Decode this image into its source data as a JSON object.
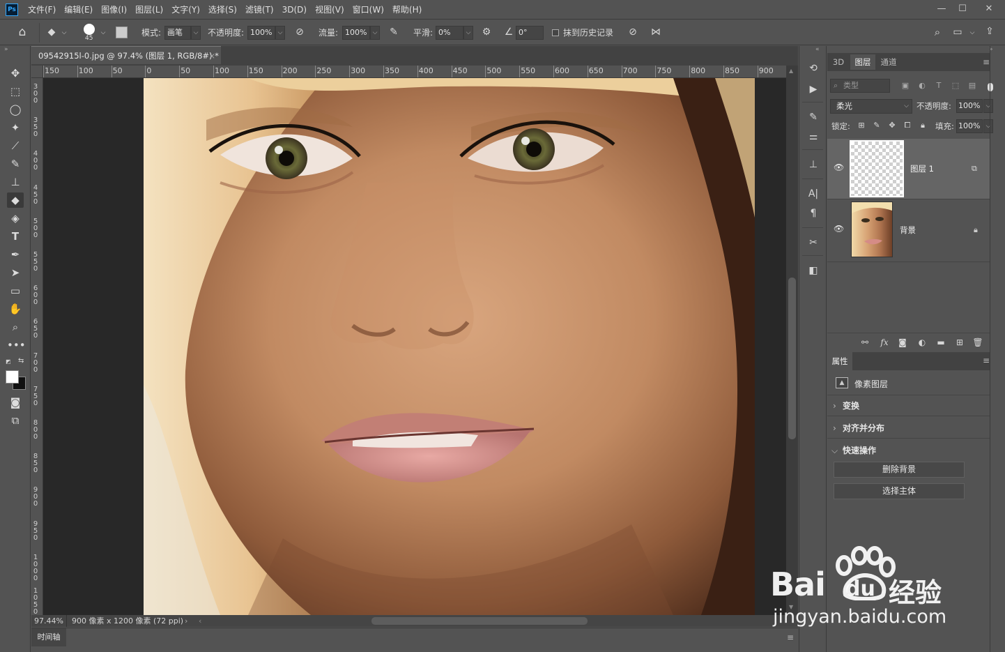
{
  "menubar": {
    "logo": "Ps",
    "items": [
      "文件(F)",
      "编辑(E)",
      "图像(I)",
      "图层(L)",
      "文字(Y)",
      "选择(S)",
      "滤镜(T)",
      "3D(D)",
      "视图(V)",
      "窗口(W)",
      "帮助(H)"
    ]
  },
  "options": {
    "brush_size": "45",
    "mode_label": "模式:",
    "mode_value": "画笔",
    "opacity_label": "不透明度:",
    "opacity_value": "100%",
    "flow_label": "流量:",
    "flow_value": "100%",
    "smoothing_label": "平滑:",
    "smoothing_value": "0%",
    "angle_value": "0°",
    "history_label": "抹到历史记录"
  },
  "document": {
    "tab_title": "09542915l-0.jpg @ 97.4% (图层 1, RGB/8#) *",
    "zoom": "97.44%",
    "dimensions": "900 像素 x 1200 像素 (72 ppi)"
  },
  "ruler": {
    "h_labels": [
      "150",
      "100",
      "50",
      "0",
      "50",
      "100",
      "150",
      "200",
      "250",
      "300",
      "350",
      "400",
      "450",
      "500",
      "550",
      "600",
      "650",
      "700",
      "750",
      "800",
      "850",
      "900"
    ],
    "v_labels": [
      "300",
      "350",
      "400",
      "450",
      "500",
      "550",
      "600",
      "650",
      "700",
      "750",
      "800",
      "850",
      "900",
      "950",
      "1000",
      "1050"
    ]
  },
  "timeline_tab": "时间轴",
  "panels": {
    "tabs": [
      "3D",
      "图层",
      "通道"
    ],
    "filter_placeholder": "类型",
    "blend_mode": "柔光",
    "opacity_label": "不透明度:",
    "opacity_value": "100%",
    "lock_label": "锁定:",
    "fill_label": "填充:",
    "fill_value": "100%",
    "layers": [
      {
        "name": "图层 1"
      },
      {
        "name": "背景"
      }
    ]
  },
  "properties": {
    "tab": "属性",
    "type_label": "像素图层",
    "sections": [
      "变换",
      "对齐并分布",
      "快速操作"
    ],
    "buttons": [
      "删除背景",
      "选择主体"
    ]
  },
  "watermark": {
    "brand": "Bai",
    "brand2": "du",
    "cn": "经验",
    "url": "jingyan.baidu.com"
  }
}
